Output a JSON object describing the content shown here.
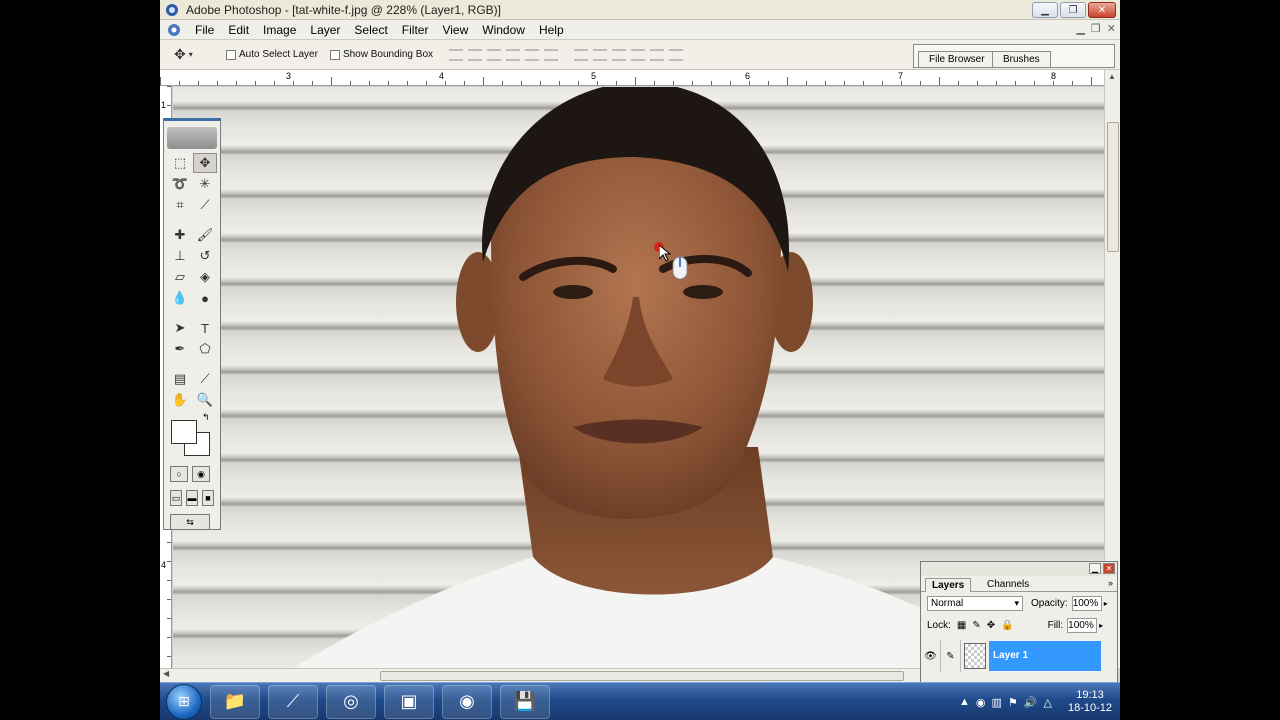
{
  "window": {
    "title": "Adobe Photoshop - [tat-white-f.jpg @ 228% (Layer1, RGB)]"
  },
  "menu": [
    "File",
    "Edit",
    "Image",
    "Layer",
    "Select",
    "Filter",
    "View",
    "Window",
    "Help"
  ],
  "options_bar": {
    "auto_select_label": "Auto Select Layer",
    "bounding_box_label": "Show Bounding Box"
  },
  "palette_well": {
    "tabs": [
      "File Browser",
      "Brushes"
    ]
  },
  "rulers": {
    "top_labels": [
      "3",
      "4",
      "5",
      "6",
      "7",
      "8"
    ],
    "left_labels": [
      "1",
      "4"
    ]
  },
  "layers_panel": {
    "tabs": [
      "Layers",
      "Channels"
    ],
    "blend_mode": "Normal",
    "opacity_label": "Opacity:",
    "opacity_value": "100%",
    "lock_label": "Lock:",
    "fill_label": "Fill:",
    "fill_value": "100%",
    "layer_name": "Layer 1"
  },
  "taskbar": {
    "time": "19:13",
    "date": "18-10-12"
  }
}
